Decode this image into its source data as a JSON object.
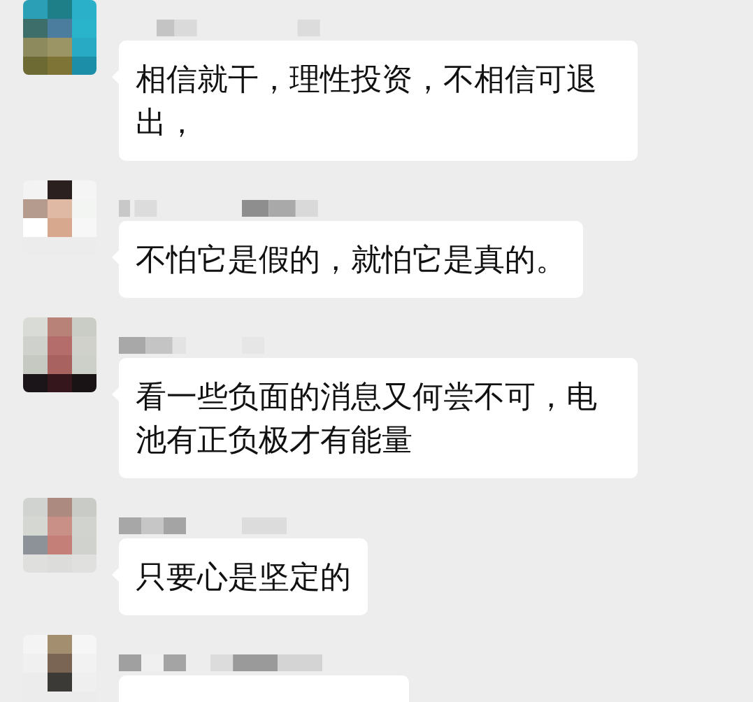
{
  "messages": [
    {
      "kind": "text",
      "text": "相信就干，理性投资，不相信可退出，"
    },
    {
      "kind": "text",
      "text": "不怕它是假的，就怕它是真的。"
    },
    {
      "kind": "text",
      "text": "看一些负面的消息又何尝不可，电池有正负极才有能量"
    },
    {
      "kind": "text",
      "text": "只要心是坚定的"
    },
    {
      "kind": "cut"
    }
  ]
}
